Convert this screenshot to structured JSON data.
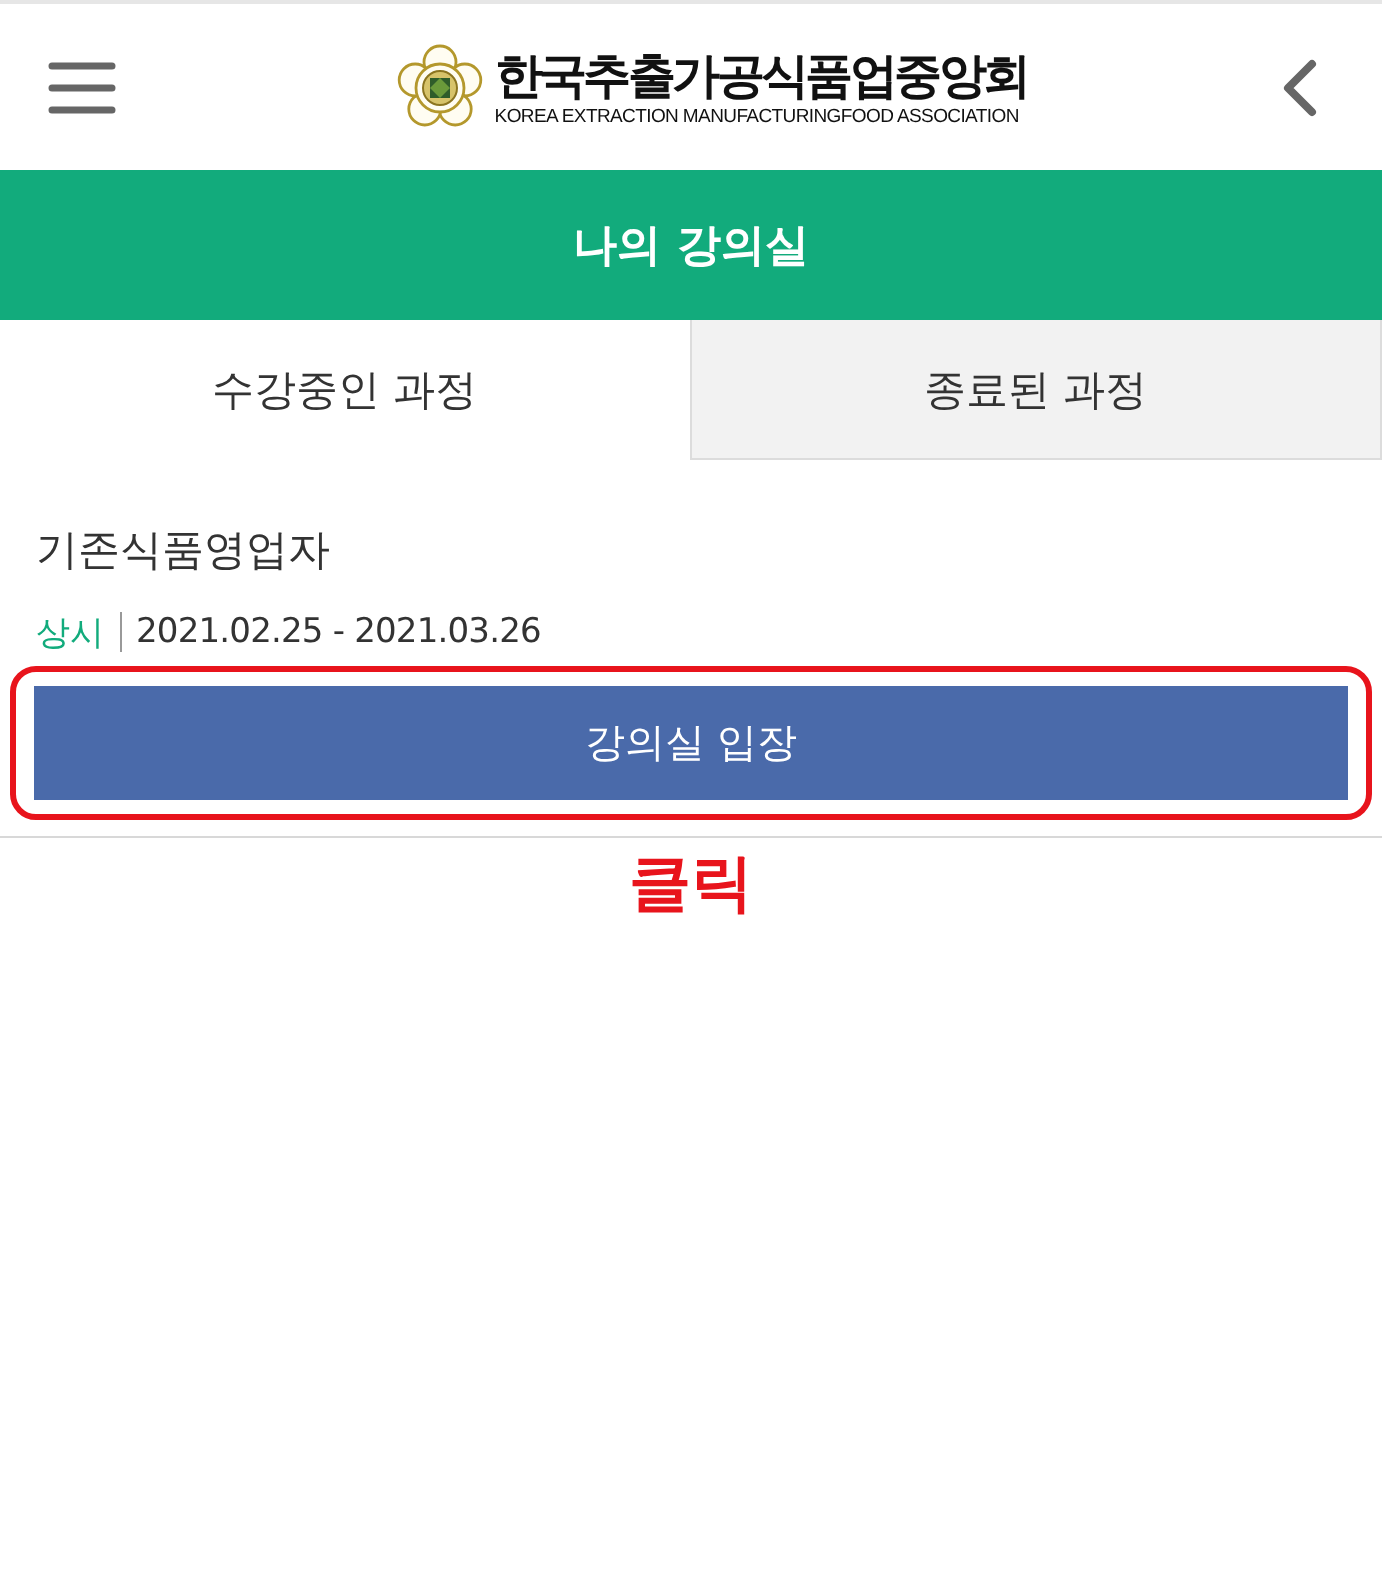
{
  "header": {
    "logo": {
      "title": "한국추출가공식품업중앙회",
      "subtitle": "KOREA EXTRACTION MANUFACTURINGFOOD ASSOCIATION"
    }
  },
  "page_title": "나의 강의실",
  "tabs": [
    {
      "label": "수강중인 과정",
      "selected": true
    },
    {
      "label": "종료된 과정",
      "selected": false
    }
  ],
  "courses": [
    {
      "title": "기존식품영업자",
      "type": "상시",
      "period": "2021.02.25 - 2021.03.26",
      "button": "강의실 입장",
      "highlighted": true
    }
  ],
  "annotation": {
    "label": "클릭"
  }
}
